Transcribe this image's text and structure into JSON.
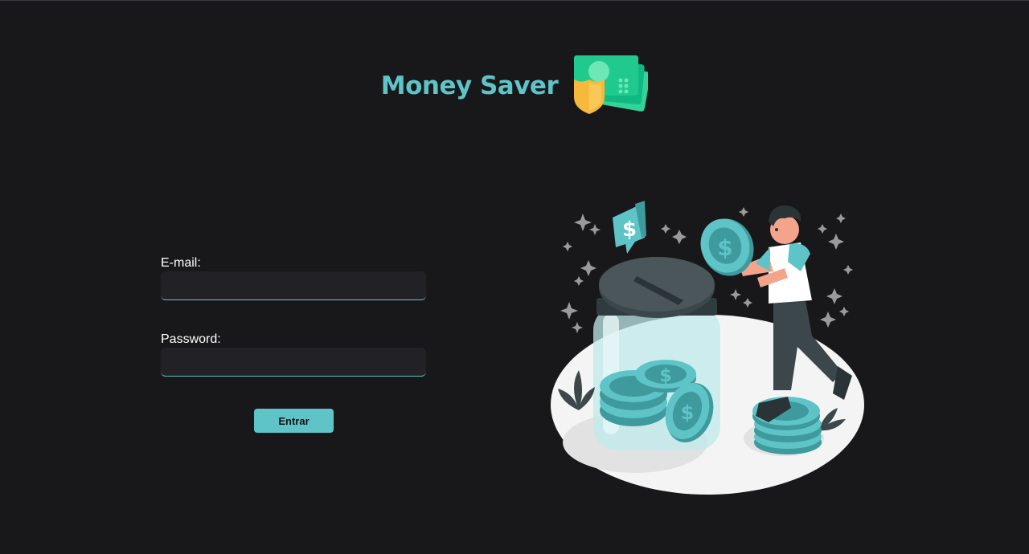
{
  "header": {
    "title": "Money Saver",
    "logo_icon": "money-shield-icon"
  },
  "login": {
    "email_label": "E-mail:",
    "email_value": "",
    "password_label": "Password:",
    "password_value": "",
    "submit_label": "Entrar"
  },
  "illustration": {
    "icon": "savings-jar-illustration"
  },
  "colors": {
    "background": "#18181b",
    "accent": "#5ec4c8",
    "input_background": "#222226"
  }
}
